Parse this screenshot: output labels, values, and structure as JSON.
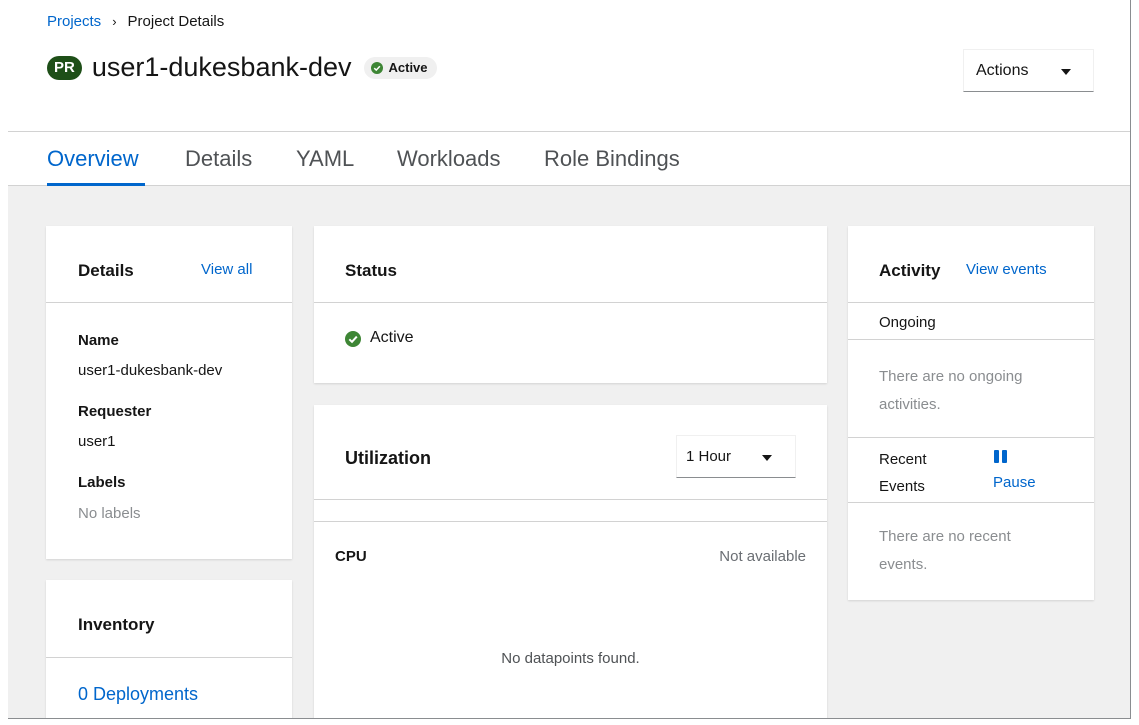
{
  "breadcrumb": {
    "parent": "Projects",
    "separator": "›",
    "current": "Project Details"
  },
  "header": {
    "badge": "PR",
    "title": "user1-dukesbank-dev",
    "status": "Active",
    "actions_label": "Actions"
  },
  "tabs": [
    {
      "label": "Overview",
      "active": true
    },
    {
      "label": "Details",
      "active": false
    },
    {
      "label": "YAML",
      "active": false
    },
    {
      "label": "Workloads",
      "active": false
    },
    {
      "label": "Role Bindings",
      "active": false
    }
  ],
  "details_card": {
    "title": "Details",
    "view_all": "View all",
    "name_label": "Name",
    "name_value": "user1-dukesbank-dev",
    "requester_label": "Requester",
    "requester_value": "user1",
    "labels_label": "Labels",
    "labels_value": "No labels"
  },
  "inventory_card": {
    "title": "Inventory",
    "deployments": "0 Deployments"
  },
  "status_card": {
    "title": "Status",
    "status": "Active"
  },
  "utilization_card": {
    "title": "Utilization",
    "range": "1 Hour",
    "cpu_label": "CPU",
    "cpu_value": "Not available",
    "empty": "No datapoints found."
  },
  "activity_card": {
    "title": "Activity",
    "view_events": "View events",
    "ongoing_label": "Ongoing",
    "ongoing_empty": "There are no ongoing activities.",
    "recent_label": "Recent Events",
    "pause_label": "Pause",
    "recent_empty": "There are no recent events."
  },
  "colors": {
    "link": "#0066cc",
    "success": "#3e8635",
    "badge": "#1e4f18",
    "background": "#f0f0f0"
  },
  "icons": {
    "status": "check-circle-icon",
    "dropdown": "caret-down-icon",
    "pause": "pause-icon"
  }
}
